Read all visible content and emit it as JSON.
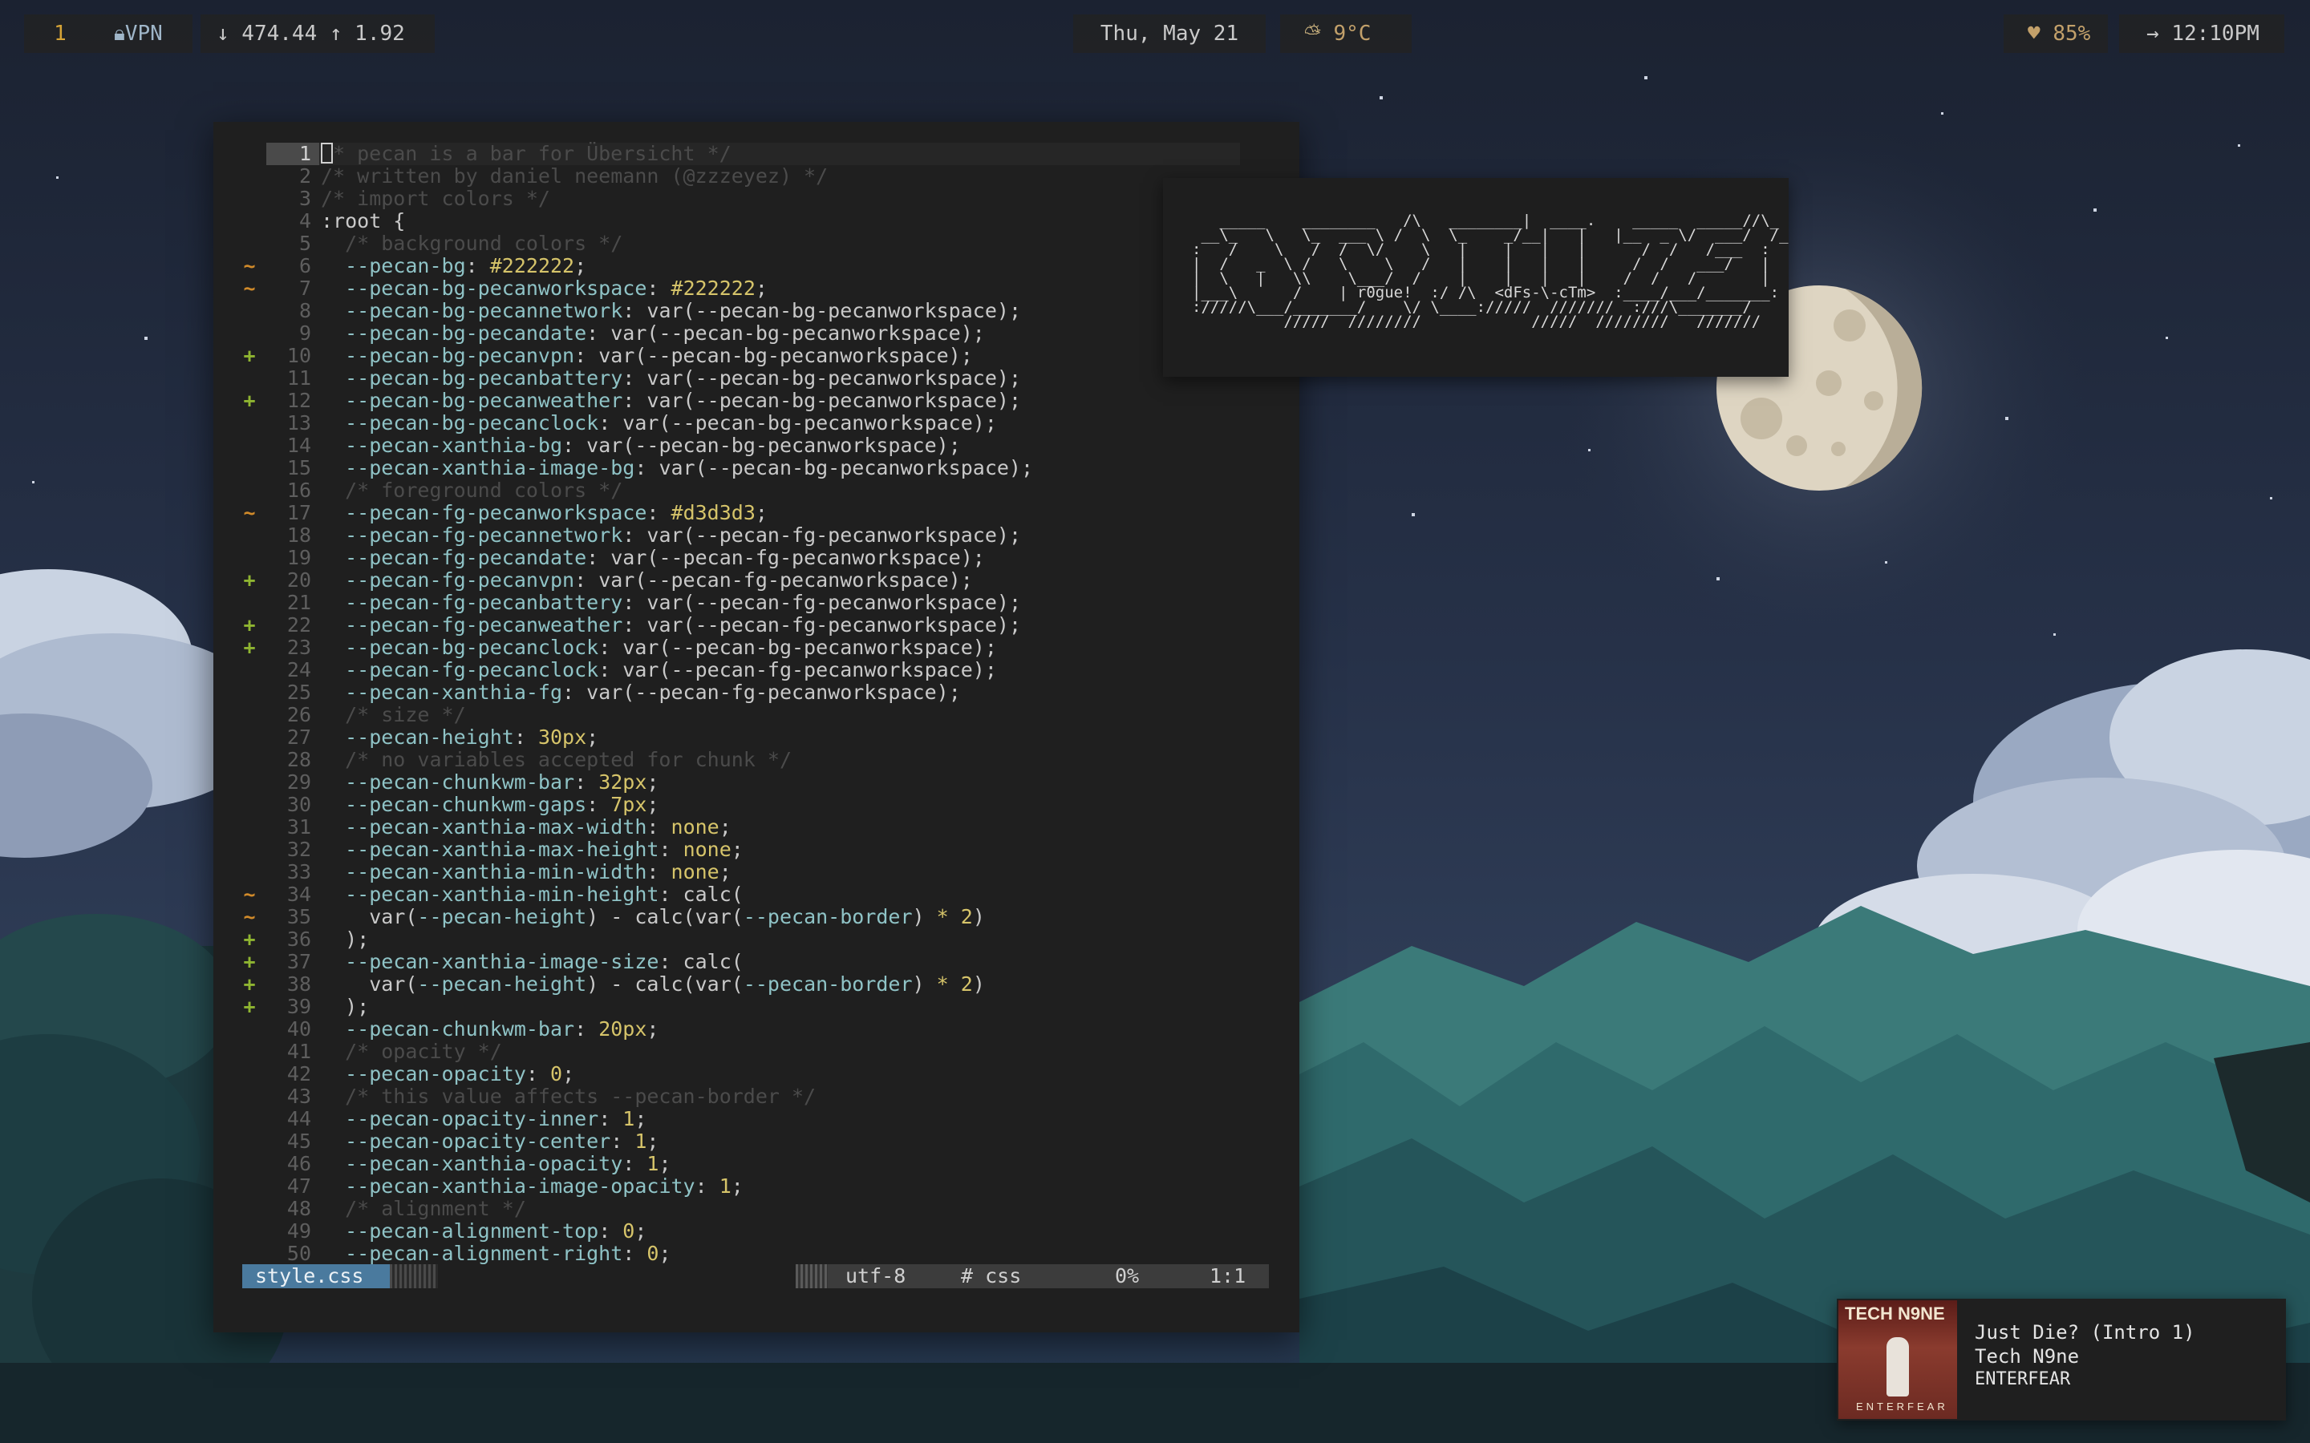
{
  "topbar": {
    "workspace": "1",
    "vpn": "VPN",
    "network": "↓ 474.44 ↑ 1.92",
    "date": "Thu, May 21",
    "weather": "9°C",
    "battery": "85%",
    "clock": "12:10PM"
  },
  "icons": {
    "vpn": "lock-icon",
    "weather": "cloud-sun-icon",
    "battery": "heart-icon",
    "clock": "arrow-right-icon"
  },
  "editor": {
    "lines": [
      {
        "n": "1",
        "sign": "",
        "text": "/* pecan is a bar for Übersicht */"
      },
      {
        "n": "2",
        "sign": "",
        "text": "/* written by daniel neemann (@zzzeyez) */"
      },
      {
        "n": "3",
        "sign": "",
        "text": "/* import colors */"
      },
      {
        "n": "4",
        "sign": "",
        "text": ":root {"
      },
      {
        "n": "5",
        "sign": "",
        "text": "  /* background colors */"
      },
      {
        "n": "6",
        "sign": "~",
        "text": "  --pecan-bg: #222222;"
      },
      {
        "n": "7",
        "sign": "~",
        "text": "  --pecan-bg-pecanworkspace: #222222;"
      },
      {
        "n": "8",
        "sign": "",
        "text": "  --pecan-bg-pecannetwork: var(--pecan-bg-pecanworkspace);"
      },
      {
        "n": "9",
        "sign": "",
        "text": "  --pecan-bg-pecandate: var(--pecan-bg-pecanworkspace);"
      },
      {
        "n": "10",
        "sign": "+",
        "text": "  --pecan-bg-pecanvpn: var(--pecan-bg-pecanworkspace);"
      },
      {
        "n": "11",
        "sign": "",
        "text": "  --pecan-bg-pecanbattery: var(--pecan-bg-pecanworkspace);"
      },
      {
        "n": "12",
        "sign": "+",
        "text": "  --pecan-bg-pecanweather: var(--pecan-bg-pecanworkspace);"
      },
      {
        "n": "13",
        "sign": "",
        "text": "  --pecan-bg-pecanclock: var(--pecan-bg-pecanworkspace);"
      },
      {
        "n": "14",
        "sign": "",
        "text": "  --pecan-xanthia-bg: var(--pecan-bg-pecanworkspace);"
      },
      {
        "n": "15",
        "sign": "",
        "text": "  --pecan-xanthia-image-bg: var(--pecan-bg-pecanworkspace);"
      },
      {
        "n": "16",
        "sign": "",
        "text": "  /* foreground colors */"
      },
      {
        "n": "17",
        "sign": "~",
        "text": "  --pecan-fg-pecanworkspace: #d3d3d3;"
      },
      {
        "n": "18",
        "sign": "",
        "text": "  --pecan-fg-pecannetwork: var(--pecan-fg-pecanworkspace);"
      },
      {
        "n": "19",
        "sign": "",
        "text": "  --pecan-fg-pecandate: var(--pecan-fg-pecanworkspace);"
      },
      {
        "n": "20",
        "sign": "+",
        "text": "  --pecan-fg-pecanvpn: var(--pecan-fg-pecanworkspace);"
      },
      {
        "n": "21",
        "sign": "",
        "text": "  --pecan-fg-pecanbattery: var(--pecan-fg-pecanworkspace);"
      },
      {
        "n": "22",
        "sign": "+",
        "text": "  --pecan-fg-pecanweather: var(--pecan-fg-pecanworkspace);"
      },
      {
        "n": "23",
        "sign": "+",
        "text": "  --pecan-bg-pecanclock: var(--pecan-bg-pecanworkspace);"
      },
      {
        "n": "24",
        "sign": "",
        "text": "  --pecan-fg-pecanclock: var(--pecan-fg-pecanworkspace);"
      },
      {
        "n": "25",
        "sign": "",
        "text": "  --pecan-xanthia-fg: var(--pecan-fg-pecanworkspace);"
      },
      {
        "n": "26",
        "sign": "",
        "text": "  /* size */"
      },
      {
        "n": "27",
        "sign": "",
        "text": "  --pecan-height: 30px;"
      },
      {
        "n": "28",
        "sign": "",
        "text": "  /* no variables accepted for chunk */"
      },
      {
        "n": "29",
        "sign": "",
        "text": "  --pecan-chunkwm-bar: 32px;"
      },
      {
        "n": "30",
        "sign": "",
        "text": "  --pecan-chunkwm-gaps: 7px;"
      },
      {
        "n": "31",
        "sign": "",
        "text": "  --pecan-xanthia-max-width: none;"
      },
      {
        "n": "32",
        "sign": "",
        "text": "  --pecan-xanthia-max-height: none;"
      },
      {
        "n": "33",
        "sign": "",
        "text": "  --pecan-xanthia-min-width: none;"
      },
      {
        "n": "34",
        "sign": "~",
        "text": "  --pecan-xanthia-min-height: calc("
      },
      {
        "n": "35",
        "sign": "~",
        "text": "    var(--pecan-height) - calc(var(--pecan-border) * 2)"
      },
      {
        "n": "36",
        "sign": "+",
        "text": "  );"
      },
      {
        "n": "37",
        "sign": "+",
        "text": "  --pecan-xanthia-image-size: calc("
      },
      {
        "n": "38",
        "sign": "+",
        "text": "    var(--pecan-height) - calc(var(--pecan-border) * 2)"
      },
      {
        "n": "39",
        "sign": "+",
        "text": "  );"
      },
      {
        "n": "40",
        "sign": "",
        "text": "  --pecan-chunkwm-bar: 20px;"
      },
      {
        "n": "41",
        "sign": "",
        "text": "  /* opacity */"
      },
      {
        "n": "42",
        "sign": "",
        "text": "  --pecan-opacity: 0;"
      },
      {
        "n": "43",
        "sign": "",
        "text": "  /* this value affects --pecan-border */"
      },
      {
        "n": "44",
        "sign": "",
        "text": "  --pecan-opacity-inner: 1;"
      },
      {
        "n": "45",
        "sign": "",
        "text": "  --pecan-opacity-center: 1;"
      },
      {
        "n": "46",
        "sign": "",
        "text": "  --pecan-xanthia-opacity: 1;"
      },
      {
        "n": "47",
        "sign": "",
        "text": "  --pecan-xanthia-image-opacity: 1;"
      },
      {
        "n": "48",
        "sign": "",
        "text": "  /* alignment */"
      },
      {
        "n": "49",
        "sign": "",
        "text": "  --pecan-alignment-top: 0;"
      },
      {
        "n": "50",
        "sign": "",
        "text": "  --pecan-alignment-right: 0;"
      }
    ],
    "status": {
      "filename": "style.css",
      "encoding": "utf-8",
      "filetype": "# css",
      "percent": "0%",
      "position": "1:1"
    },
    "colors": {
      "sign_modified": "#d08a2a",
      "sign_added": "#8fb531",
      "property": "#8fc3c6",
      "number": "#d6c46a",
      "comment": "#4b4b4b"
    }
  },
  "ascii_art": {
    "lines": [
      "   _____    ________   /\\   ________|  ____.    _____  _____//\\_",
      " __\\_   \\   \\_  ___ \\ /  \\  \\_    _/__|   |   |__  _ \\/  ___/  /_",
      ":   /    \\   /  /  \\/    \\   |    |   |   |      /  /   /___  :",
      "|  /   _  \\ /   \\    \\   /   |    |   |   |     /  /   ___/   |",
      "|  \\   |   \\\\    \\___/  /    |    |   |   |    /  /   /       |",
      "|___\\      /    | r0gue!  :/ /\\  <dFs-\\-cTm>  :____/___/_______:",
      "://///\\___/_______/    \\/ \\____://///  ///////  :///\\_______/",
      "          /////  ////////            /////  ////////   ///////"
    ],
    "credits": "r0gue! <dFs-\\-cTm>"
  },
  "now_playing": {
    "track": "Just Die? (Intro 1)",
    "artist": "Tech N9ne",
    "album": "ENTERFEAR",
    "cover_title": "TECH N9NE",
    "cover_footer": "ENTERFEAR"
  }
}
